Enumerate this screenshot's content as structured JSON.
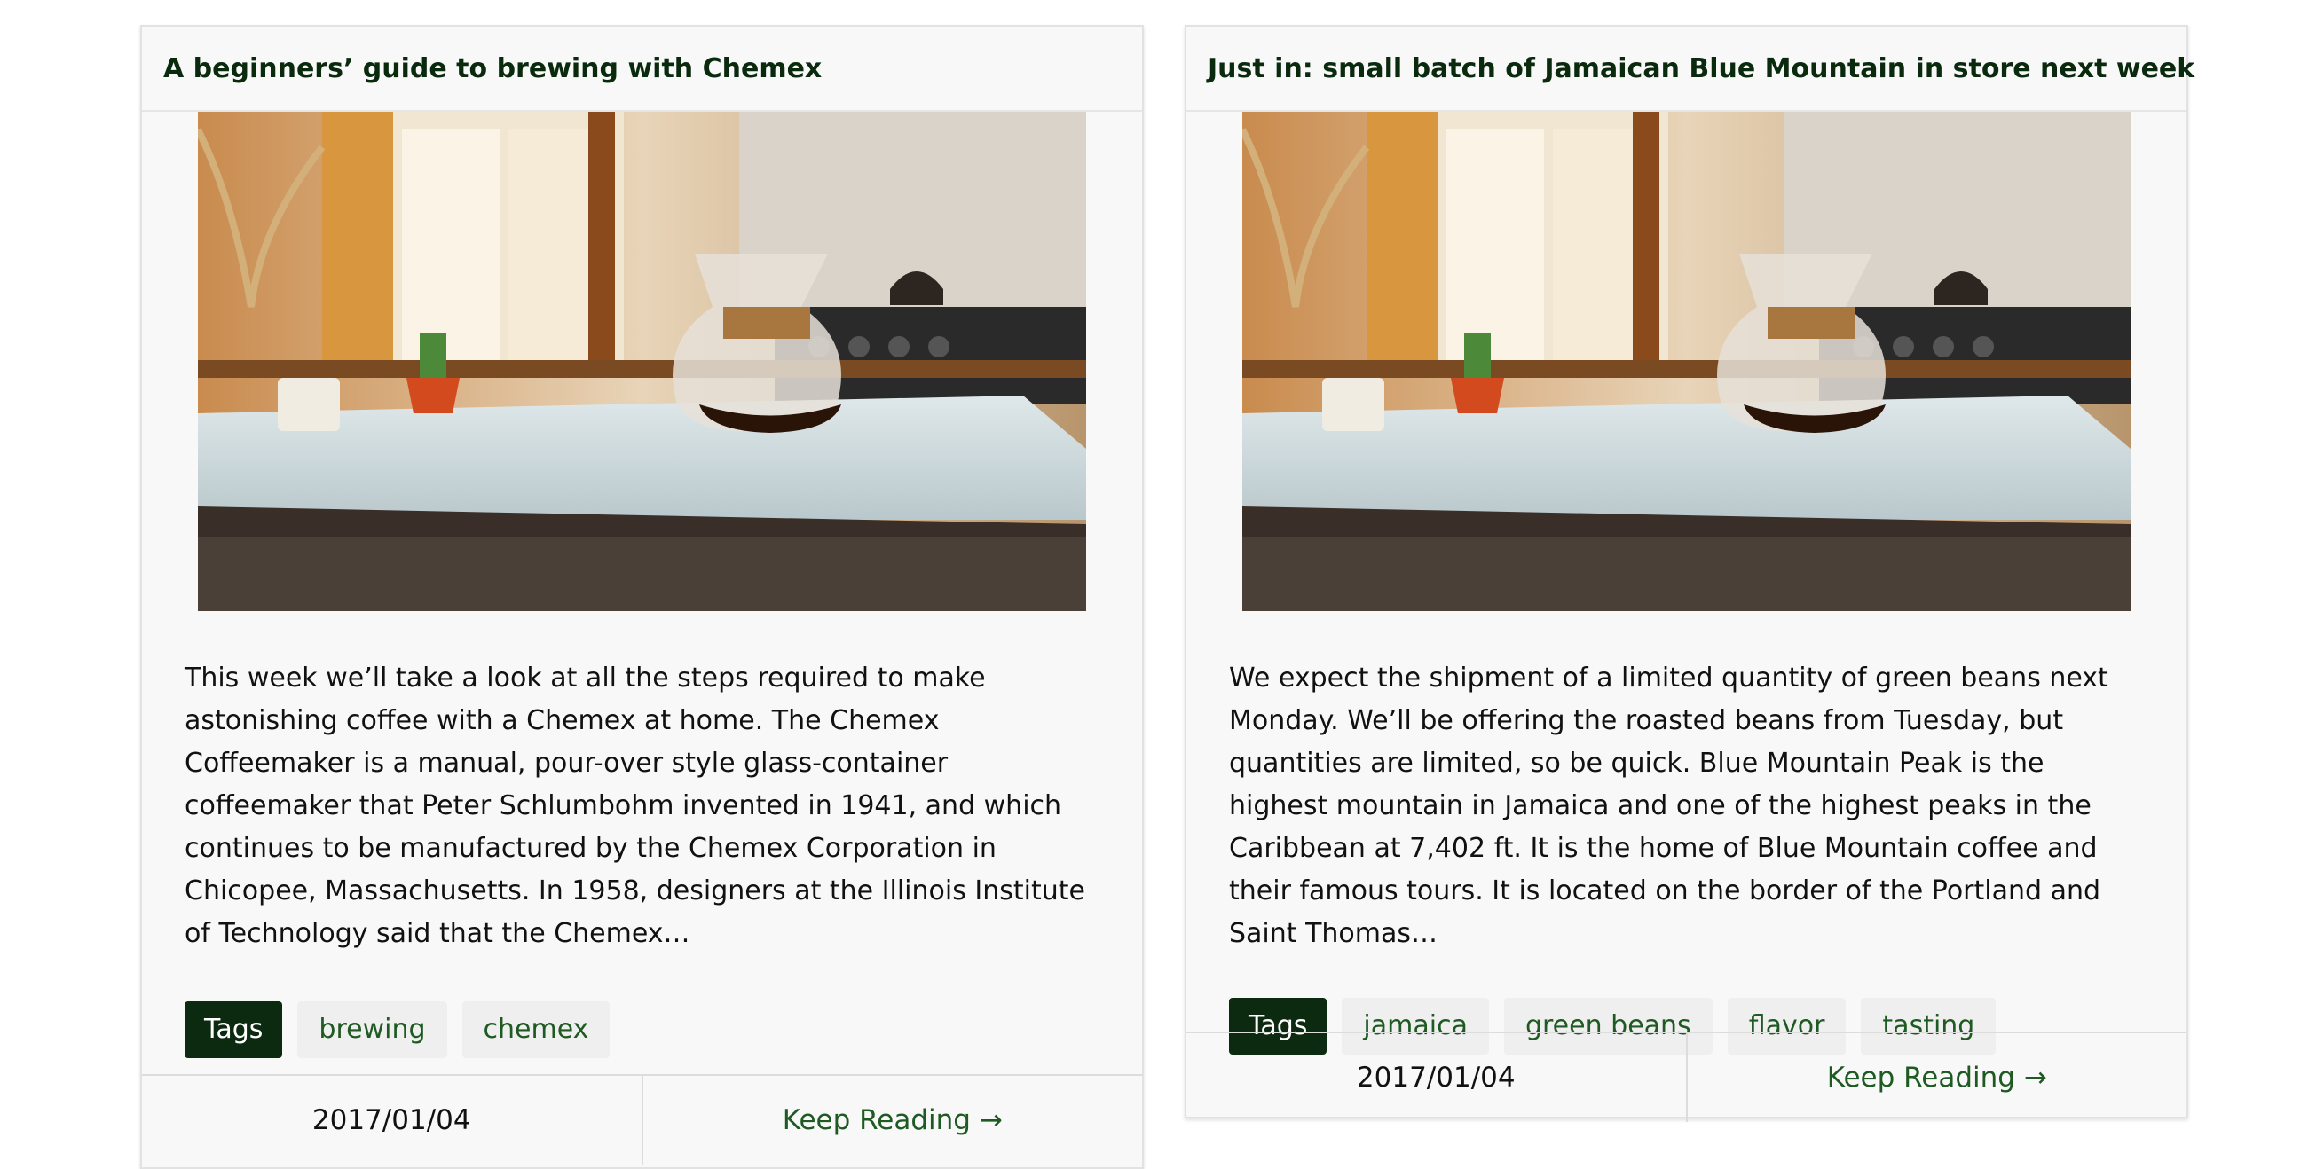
{
  "cards": [
    {
      "title": "A beginners’ guide to brewing with Chemex",
      "excerpt": "This week we’ll take a look at all the steps required to make astonishing coffee with a Chemex at home. The Chemex Coffeemaker is a manual, pour-over style glass-container coffeemaker that Peter Schlumbohm invented in 1941, and which continues to be manufactured by the Chemex Corporation in Chicopee, Massachusetts. In 1958, designers at the Illinois Institute of Technology said that the Chemex…",
      "tags_label": "Tags",
      "tags": [
        "brewing",
        "chemex"
      ],
      "date": "2017/01/04",
      "read_more": "Keep Reading →"
    },
    {
      "title": "Just in: small batch of Jamaican Blue Mountain in store next week",
      "excerpt": "We expect the shipment of a limited quantity of green beans next Monday. We’ll be offering the roasted beans from Tuesday, but quantities are limited, so be quick. Blue Mountain Peak is the highest mountain in Jamaica and one of the highest peaks in the Caribbean at 7,402 ft. It is the home of Blue Mountain coffee and their famous tours. It is located on the border of the Portland and Saint Thomas…",
      "tags_label": "Tags",
      "tags": [
        "jamaica",
        "green beans",
        "flavor",
        "tasting"
      ],
      "date": "2017/01/04",
      "read_more": "Keep Reading →"
    }
  ],
  "colors": {
    "brand_dark_green": "#0c2a10",
    "link_green": "#1f5a22",
    "card_background": "#f8f8f8"
  }
}
